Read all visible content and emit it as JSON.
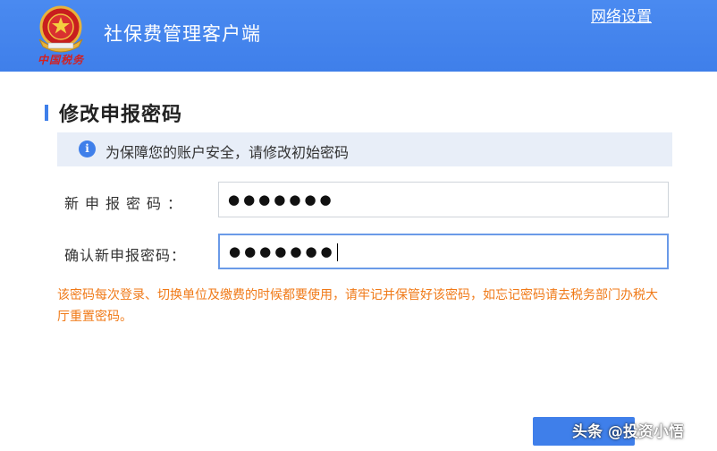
{
  "header": {
    "logo_caption": "中国税务",
    "app_title": "社保费管理客户端",
    "network_settings_label": "网络设置"
  },
  "section": {
    "title": "修改申报密码"
  },
  "notice": {
    "icon_glyph": "i",
    "text": "为保障您的账户安全，请修改初始密码"
  },
  "form": {
    "new_password_label": "新申报密码：",
    "new_password_value": "●●●●●●●",
    "confirm_password_label": "确认新申报密码：",
    "confirm_password_value": "●●●●●●●"
  },
  "warning_text": "该密码每次登录、切换单位及缴费的时候都要使用，请牢记并保管好该密码，如忘记密码请去税务部门办税大厅重置密码。",
  "watermark": "头条 @投资小悟",
  "colors": {
    "header_blue": "#3f7fea",
    "warning_orange": "#f07a18",
    "notice_bg": "#e8eef8"
  },
  "icons": {
    "logo": "national-emblem-icon",
    "notice": "info-icon"
  }
}
